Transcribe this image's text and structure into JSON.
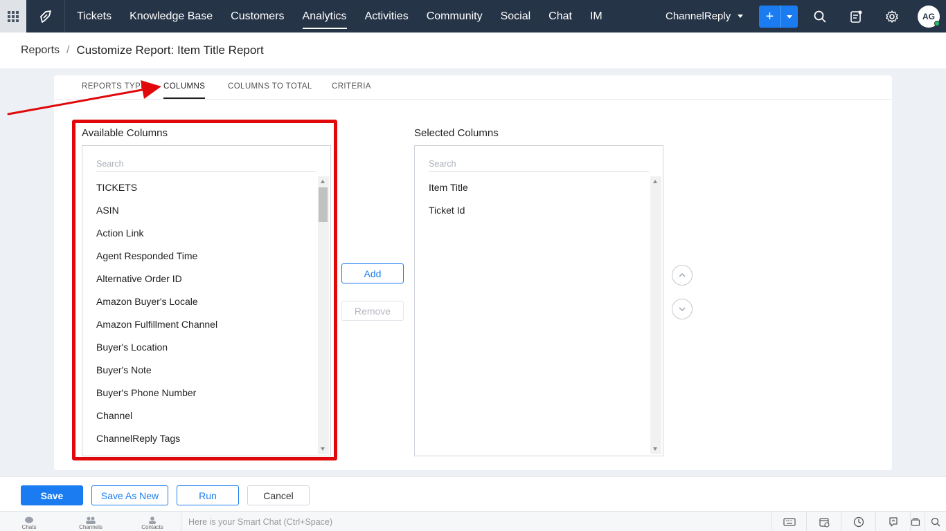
{
  "nav": {
    "items": [
      "Tickets",
      "Knowledge Base",
      "Customers",
      "Analytics",
      "Activities",
      "Community",
      "Social",
      "Chat",
      "IM"
    ],
    "active": "Analytics",
    "department": "ChannelReply",
    "avatar_initials": "AG",
    "icons": [
      "apps-grid-icon",
      "desk-logo-icon",
      "plus-icon",
      "search-icon",
      "notes-icon",
      "gear-icon"
    ]
  },
  "breadcrumb": {
    "parent": "Reports",
    "separator": "/",
    "current": "Customize Report: Item Title Report"
  },
  "tabs": [
    "REPORTS TYPE",
    "COLUMNS",
    "COLUMNS TO TOTAL",
    "CRITERIA"
  ],
  "active_tab": "COLUMNS",
  "available": {
    "title": "Available Columns",
    "search_placeholder": "Search",
    "items": [
      "TICKETS",
      "ASIN",
      "Action Link",
      "Agent Responded Time",
      "Alternative Order ID",
      "Amazon Buyer's Locale",
      "Amazon Fulfillment Channel",
      "Buyer's Location",
      "Buyer's Note",
      "Buyer's Phone Number",
      "Channel",
      "ChannelReply Tags"
    ]
  },
  "selected": {
    "title": "Selected Columns",
    "search_placeholder": "Search",
    "items": [
      "Item Title",
      "Ticket Id"
    ]
  },
  "actions": {
    "add": "Add",
    "remove": "Remove"
  },
  "footer": {
    "save": "Save",
    "save_as_new": "Save As New",
    "run": "Run",
    "cancel": "Cancel"
  },
  "bottombar": {
    "chats": "Chats",
    "channels": "Channels",
    "contacts": "Contacts",
    "smart_chat_placeholder": "Here is your Smart Chat (Ctrl+Space)"
  },
  "annotation": {
    "highlight_color": "#e0080b"
  },
  "colors": {
    "nav_bg": "#263447",
    "accent": "#1a7cf0"
  }
}
